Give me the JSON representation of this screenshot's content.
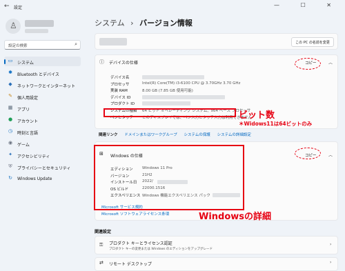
{
  "window": {
    "title": "設定",
    "controls": "— ☐ ✕"
  },
  "sidebar": {
    "search_placeholder": "設定の検索",
    "items": [
      {
        "label": "システム",
        "icon": "▭",
        "icon_name": "monitor-icon",
        "color": "#0067c0",
        "selected": true
      },
      {
        "label": "Bluetooth とデバイス",
        "icon": "✱",
        "icon_name": "bluetooth-icon",
        "color": "#0067c0"
      },
      {
        "label": "ネットワークとインターネット",
        "icon": "◆",
        "icon_name": "wifi-icon",
        "color": "#2a6fb8"
      },
      {
        "label": "個人用設定",
        "icon": "✎",
        "icon_name": "pen-icon",
        "color": "#c98a22"
      },
      {
        "label": "アプリ",
        "icon": "▦",
        "icon_name": "apps-icon",
        "color": "#5b6a7a"
      },
      {
        "label": "アカウント",
        "icon": "●",
        "icon_name": "account-icon",
        "color": "#1f9e57"
      },
      {
        "label": "時刻と言語",
        "icon": "◷",
        "icon_name": "clock-icon",
        "color": "#1f76c2"
      },
      {
        "label": "ゲーム",
        "icon": "◉",
        "icon_name": "game-icon",
        "color": "#6b7280"
      },
      {
        "label": "アクセシビリティ",
        "icon": "✦",
        "icon_name": "accessibility-icon",
        "color": "#2a6fb8"
      },
      {
        "label": "プライバシーとセキュリティ",
        "icon": "⛨",
        "icon_name": "shield-icon",
        "color": "#6b7280"
      },
      {
        "label": "Windows Update",
        "icon": "↻",
        "icon_name": "update-icon",
        "color": "#1f76c2"
      }
    ]
  },
  "main": {
    "breadcrumb": {
      "parent": "システム",
      "sep": "›",
      "current": "バージョン情報"
    },
    "rename_button": "この PC の名前を変更",
    "device_specs": {
      "title": "デバイスの仕様",
      "copy": "コピー",
      "rows": [
        {
          "label": "デバイス名",
          "value": ""
        },
        {
          "label": "プロセッサ",
          "value": "Intel(R) Core(TM) i3-6100 CPU @ 3.70GHz   3.70 GHz"
        },
        {
          "label": "実装 RAM",
          "value": "8.00 GB (7.85 GB 使用可能)"
        },
        {
          "label": "デバイス ID",
          "value": ""
        },
        {
          "label": "プロダクト ID",
          "value": ""
        },
        {
          "label": "システムの種類",
          "value": "64 ビット オペレーティング システム、x64 ベース プロセッサ"
        },
        {
          "label": "ペンとタッチ",
          "value": "このディスプレイでは、ペン入力とタッチ入力は利用できません"
        }
      ]
    },
    "related_links": {
      "title": "関連リンク",
      "links": [
        "ドメインまたはワークグループ",
        "システムの保護",
        "システムの詳細設定"
      ]
    },
    "windows_specs": {
      "title": "Windows の仕様",
      "copy": "コピー",
      "rows": [
        {
          "label": "エディション",
          "value": "Windows 11 Pro"
        },
        {
          "label": "バージョン",
          "value": "21H2"
        },
        {
          "label": "インストール日",
          "value": "2022/"
        },
        {
          "label": "OS ビルド",
          "value": "22000.1516"
        },
        {
          "label": "エクスペリエンス",
          "value": "Windows 機能エクスペリエンス パック"
        }
      ],
      "links": [
        "Microsoft サービス規約",
        "Microsoft ソフトウェアライセンス条項"
      ]
    },
    "related_settings": {
      "title": "関連設定",
      "items": [
        {
          "title": "プロダクト キーとライセンス認証",
          "subtitle": "プロダクト キーの変更または Windows のエディションをアップグレード"
        },
        {
          "title": "リモート デスクトップ"
        }
      ]
    }
  },
  "annotations": {
    "bit_label": "ビット数",
    "bit_note": "＊Widows11は64ビットのみ",
    "details_label": "Windowsの詳細",
    "color": "#e60012"
  }
}
